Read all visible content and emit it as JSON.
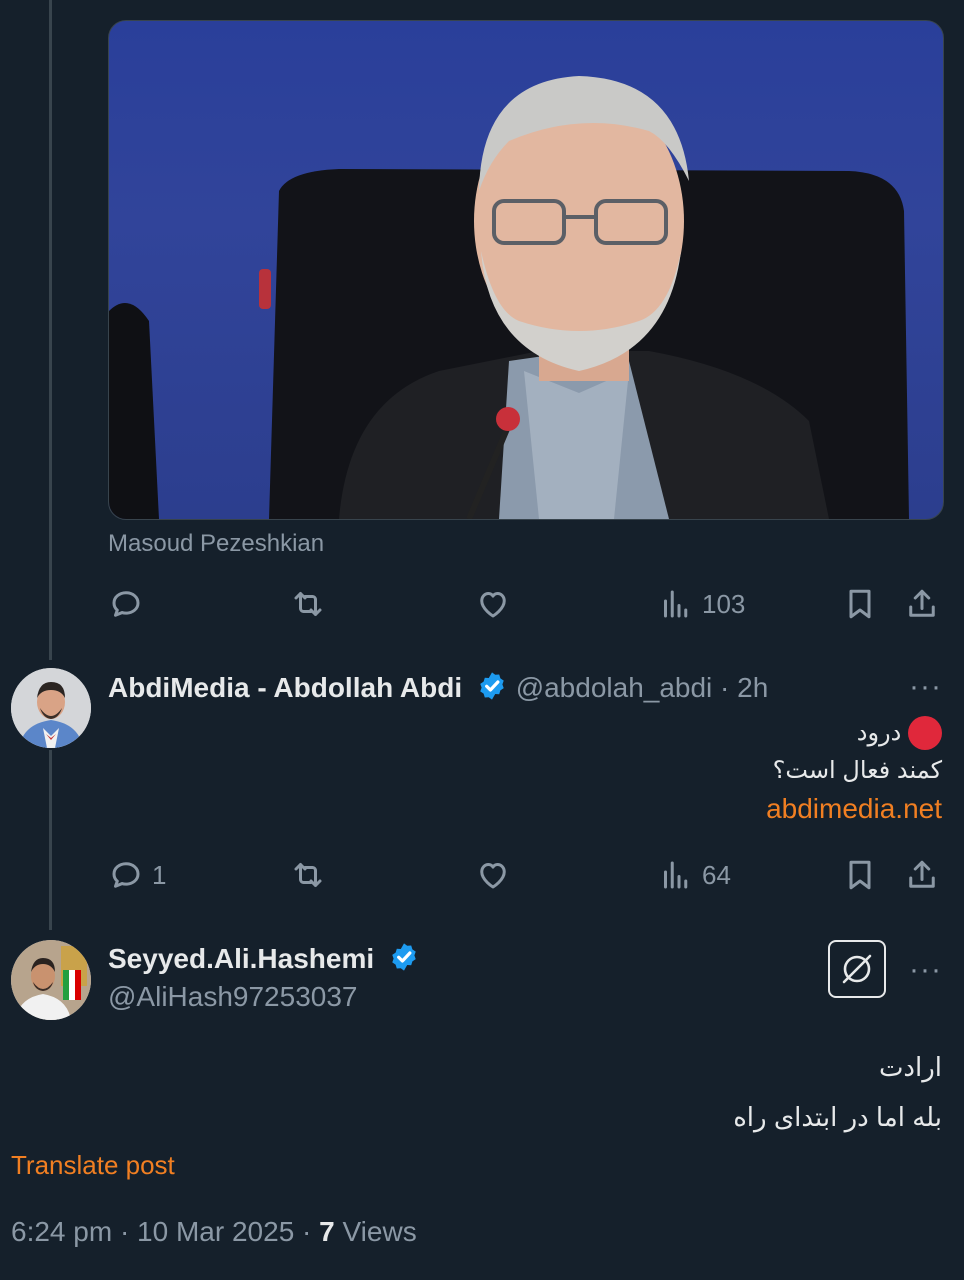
{
  "post1": {
    "caption": "Masoud Pezeshkian",
    "views": "103",
    "reply_count": "",
    "repost_icon": "repost-icon",
    "like_icon": "heart-icon"
  },
  "reply": {
    "display_name": "AbdiMedia - Abdollah Abdi",
    "handle_time": "@abdolah_abdi · 2h",
    "more": "···",
    "line1": "درود",
    "line2": "کمند فعال است؟",
    "link": "abdimedia.net",
    "reply_count": "1",
    "views": "64"
  },
  "main": {
    "display_name": "Seyyed.Ali.Hashemi",
    "handle": "@AliHash97253037",
    "more": "···",
    "line1": "ارادت",
    "line2": "بله اما در ابتدای راه",
    "translate": "Translate post",
    "datetime": "6:24 pm · 10 Mar 2025 · ",
    "views_count": "7",
    "views_label": " Views"
  },
  "colors": {
    "background": "#15202b",
    "accent_link": "#f17f22",
    "verified": "#1d9bf0",
    "muted": "#8b98a5"
  }
}
